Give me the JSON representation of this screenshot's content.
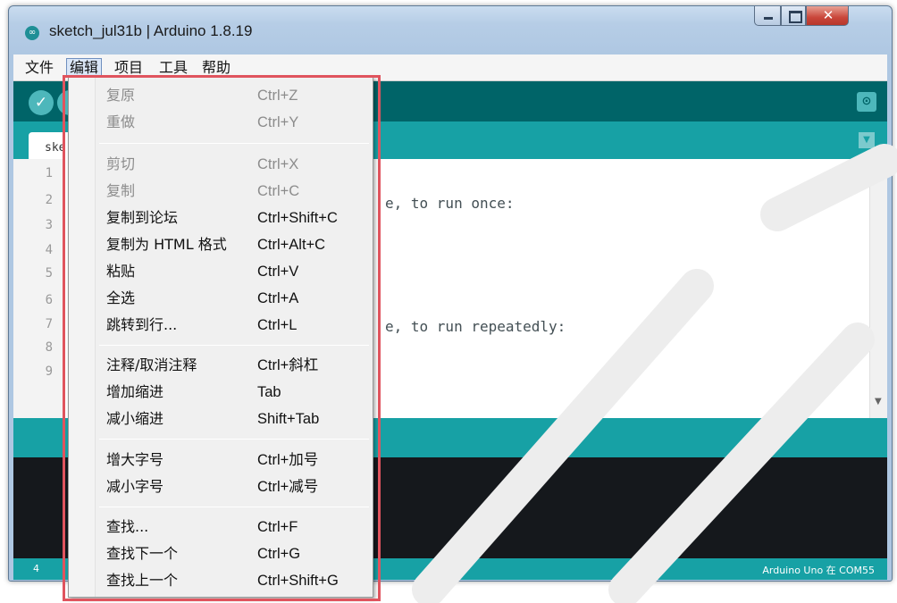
{
  "window": {
    "title": "sketch_jul31b | Arduino 1.8.19",
    "app_icon_glyph": "∞"
  },
  "menubar": {
    "items": [
      {
        "label": "文件"
      },
      {
        "label": "编辑",
        "active": true
      },
      {
        "label": "项目"
      },
      {
        "label": "工具"
      },
      {
        "label": "帮助"
      }
    ]
  },
  "toolbar": {
    "verify_glyph": "✓",
    "serial_monitor_glyph": "⊙"
  },
  "tab": {
    "label": "ske"
  },
  "editor": {
    "line_numbers": [
      "1",
      "2",
      "3",
      "4",
      "5",
      "6",
      "7",
      "8",
      "9"
    ],
    "visible_code": [
      {
        "line": 2,
        "text": "e, to run once:"
      },
      {
        "line": 7,
        "text": "e, to run repeatedly:"
      }
    ]
  },
  "footer": {
    "line": "4",
    "board": "Arduino Uno 在 COM55"
  },
  "edit_menu": {
    "groups": [
      [
        {
          "label": "复原",
          "shortcut": "Ctrl+Z",
          "enabled": false
        },
        {
          "label": "重做",
          "shortcut": "Ctrl+Y",
          "enabled": false
        }
      ],
      [
        {
          "label": "剪切",
          "shortcut": "Ctrl+X",
          "enabled": false
        },
        {
          "label": "复制",
          "shortcut": "Ctrl+C",
          "enabled": false
        },
        {
          "label": "复制到论坛",
          "shortcut": "Ctrl+Shift+C",
          "enabled": true
        },
        {
          "label": "复制为 HTML 格式",
          "shortcut": "Ctrl+Alt+C",
          "enabled": true
        },
        {
          "label": "粘贴",
          "shortcut": "Ctrl+V",
          "enabled": true
        },
        {
          "label": "全选",
          "shortcut": "Ctrl+A",
          "enabled": true
        },
        {
          "label": "跳转到行...",
          "shortcut": "Ctrl+L",
          "enabled": true
        }
      ],
      [
        {
          "label": "注释/取消注释",
          "shortcut": "Ctrl+斜杠",
          "enabled": true
        },
        {
          "label": "增加缩进",
          "shortcut": "Tab",
          "enabled": true
        },
        {
          "label": "减小缩进",
          "shortcut": "Shift+Tab",
          "enabled": true
        }
      ],
      [
        {
          "label": "增大字号",
          "shortcut": "Ctrl+加号",
          "enabled": true
        },
        {
          "label": "减小字号",
          "shortcut": "Ctrl+减号",
          "enabled": true
        }
      ],
      [
        {
          "label": "查找...",
          "shortcut": "Ctrl+F",
          "enabled": true
        },
        {
          "label": "查找下一个",
          "shortcut": "Ctrl+G",
          "enabled": true
        },
        {
          "label": "查找上一个",
          "shortcut": "Ctrl+Shift+G",
          "enabled": true
        }
      ]
    ]
  },
  "colors": {
    "toolbar_dark_teal": "#006468",
    "tab_teal": "#17a1a5",
    "highlight_red": "#e0545e"
  }
}
